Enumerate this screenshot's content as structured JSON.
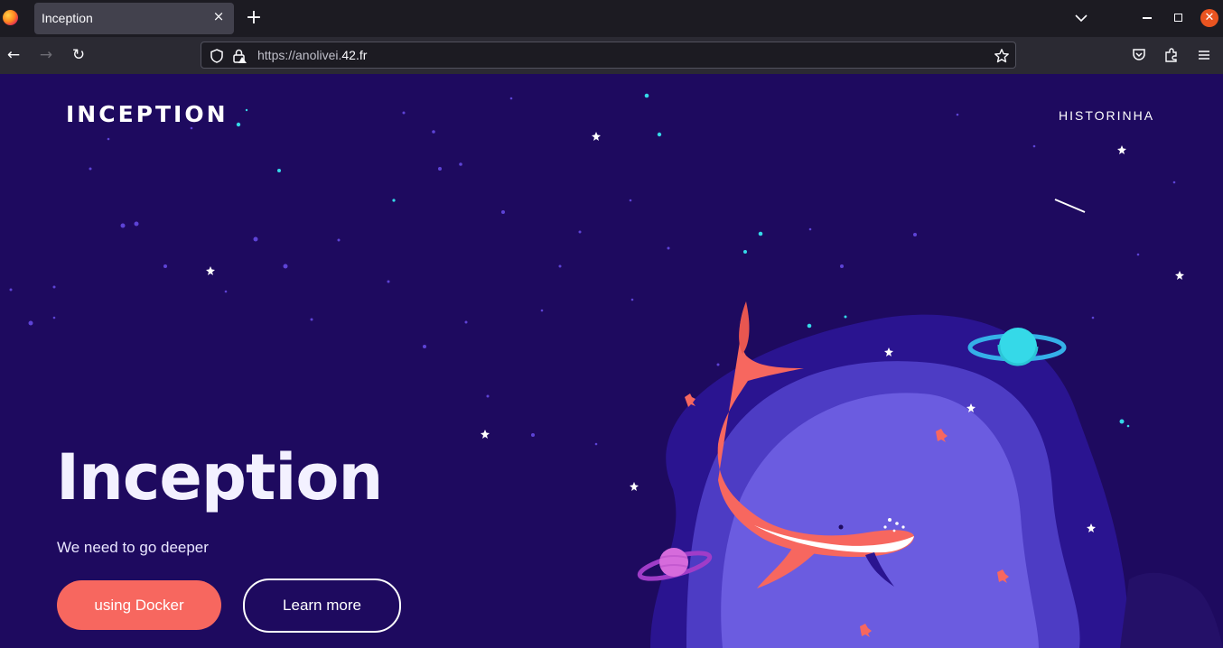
{
  "browser": {
    "tab_title": "Inception",
    "tab_close_symbol": "×",
    "new_tab_symbol": "+",
    "url_scheme_host_prefix": "https://anolivei.",
    "url_host_bold": "42.fr",
    "back_symbol": "←",
    "forward_symbol": "→",
    "reload_symbol": "↻",
    "window_close_symbol": "✕",
    "icons": [
      "firefox-logo-icon",
      "close-icon",
      "plus-icon",
      "chevron-down-icon",
      "minimize-icon",
      "maximize-icon",
      "window-close-icon",
      "back-arrow-icon",
      "forward-arrow-icon",
      "reload-icon",
      "shield-icon",
      "insecure-lock-icon",
      "star-bookmark-icon",
      "pocket-icon",
      "extensions-icon",
      "hamburger-menu-icon"
    ]
  },
  "site": {
    "brand": "INCEPTION",
    "nav_link": "HISTORINHA",
    "hero_title": "Inception",
    "hero_subtitle": "We need to go deeper",
    "primary_button": "using Docker",
    "secondary_button": "Learn more"
  },
  "colors": {
    "page_background": "#1e0a5f",
    "primary_button": "#f7675f",
    "whale": "#f7675f",
    "planet_cyan": "#35d9e8",
    "planet_pink": "#d66bdc",
    "blob_light": "#6b5ce0",
    "blob_dark": "#2a1490"
  }
}
